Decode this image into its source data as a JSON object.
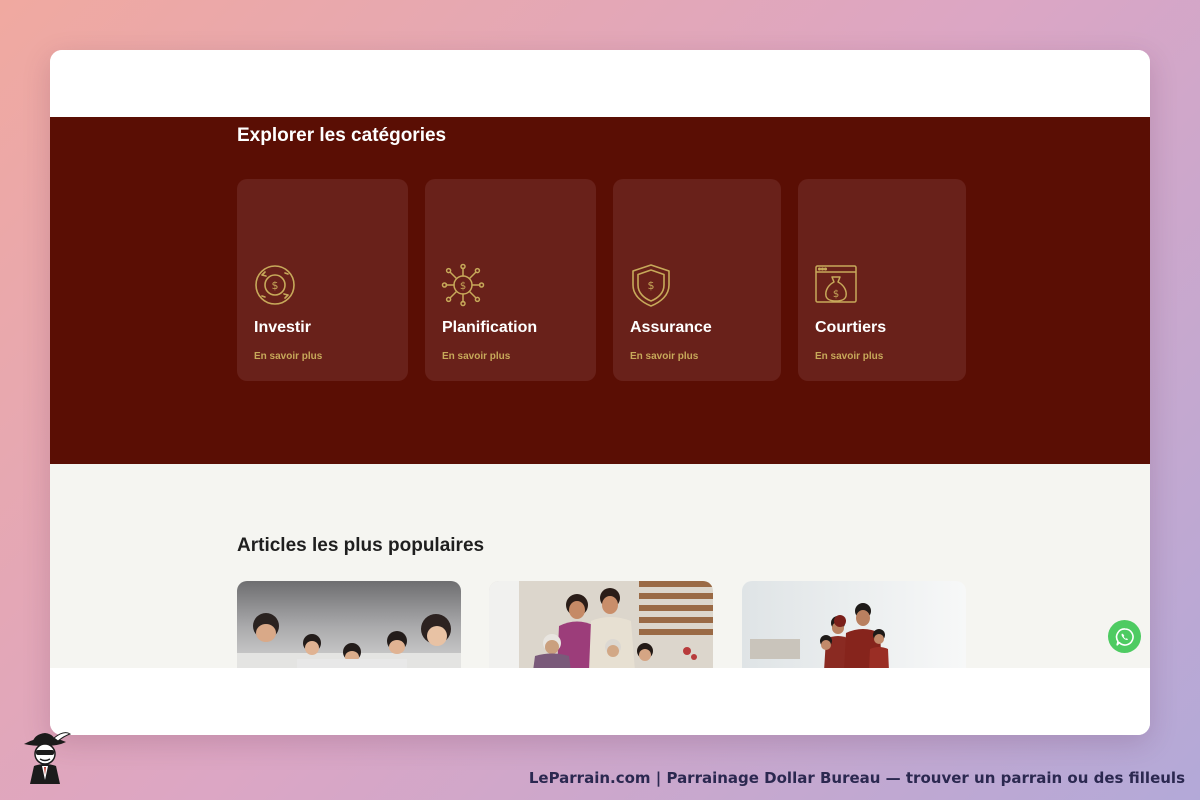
{
  "categories": {
    "title": "Explorer les catégories",
    "items": [
      {
        "name": "Investir",
        "link": "En savoir plus",
        "icon": "investment-cycle-icon"
      },
      {
        "name": "Planification",
        "link": "En savoir plus",
        "icon": "planning-network-icon"
      },
      {
        "name": "Assurance",
        "link": "En savoir plus",
        "icon": "shield-dollar-icon"
      },
      {
        "name": "Courtiers",
        "link": "En savoir plus",
        "icon": "money-bag-browser-icon"
      }
    ],
    "colors": {
      "background": "#5a0e04",
      "tile": "#69211a",
      "accent": "#c7a95a"
    }
  },
  "popular": {
    "title": "Articles les plus populaires",
    "articles": [
      {
        "image": "family-lying-on-floor-photo"
      },
      {
        "image": "multigenerational-family-photo"
      },
      {
        "image": "family-at-home-photo"
      }
    ]
  },
  "whatsapp": {
    "icon": "whatsapp-icon",
    "color": "#4ecb62"
  },
  "footer": {
    "text": "LeParrain.com | Parrainage Dollar Bureau — trouver un parrain ou des filleuls"
  }
}
